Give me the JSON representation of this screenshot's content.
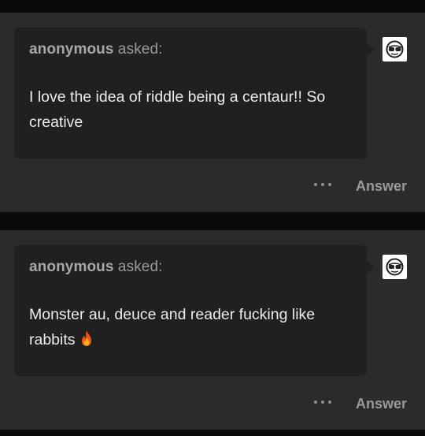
{
  "posts": [
    {
      "asker_name": "anonymous",
      "asked_label": "asked:",
      "question": "I love the idea of riddle being a centaur!! So creative",
      "has_emoji": false,
      "answer_label": "Answer",
      "avatar_icon": "sunglasses-face-icon"
    },
    {
      "asker_name": "anonymous",
      "asked_label": "asked:",
      "question": "Monster au, deuce and reader fucking like rabbits",
      "has_emoji": true,
      "emoji_icon": "fire-emoji-icon",
      "answer_label": "Answer",
      "avatar_icon": "sunglasses-face-icon"
    }
  ],
  "colors": {
    "page_bg": "#0a0a0a",
    "card_bg": "#2b2b2b",
    "bubble_bg": "#202020",
    "text_primary": "#ececec",
    "text_muted": "#9a9a9a"
  }
}
